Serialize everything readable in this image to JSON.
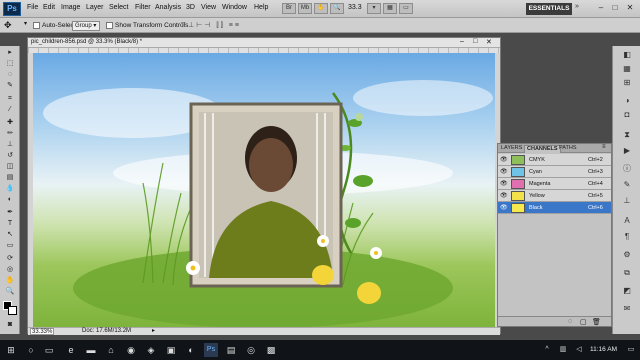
{
  "app": {
    "logo": "Ps"
  },
  "menu": [
    "File",
    "Edit",
    "Image",
    "Layer",
    "Select",
    "Filter",
    "Analysis",
    "3D",
    "View",
    "Window",
    "Help"
  ],
  "appbar": {
    "zoom": "33.3",
    "workspace": "ESSENTIALS",
    "cs_live": "»"
  },
  "options": {
    "auto_select_label": "Auto-Select:",
    "auto_select_value": "Group",
    "transform_label": "Show Transform Controls"
  },
  "document": {
    "tab_title": "pic_children-856.psd @ 33.3% (Black/8) *",
    "zoom_status": "33.33%",
    "doc_info": "Doc: 17.6M/13.2M"
  },
  "panel": {
    "tabs": [
      "LAYERS",
      "CHANNELS",
      "PATHS"
    ],
    "active_tab": "CHANNELS",
    "channels": [
      {
        "name": "CMYK",
        "shortcut": "Ctrl+2",
        "thumb_color": "#8fbf5a",
        "selected": false,
        "visible": true
      },
      {
        "name": "Cyan",
        "shortcut": "Ctrl+3",
        "thumb_color": "#6fc3e6",
        "selected": false,
        "visible": true
      },
      {
        "name": "Magenta",
        "shortcut": "Ctrl+4",
        "thumb_color": "#e06fb0",
        "selected": false,
        "visible": true
      },
      {
        "name": "Yellow",
        "shortcut": "Ctrl+5",
        "thumb_color": "#f2e14a",
        "selected": false,
        "visible": true
      },
      {
        "name": "Black",
        "shortcut": "Ctrl+6",
        "thumb_color": "#f5e94e",
        "selected": true,
        "visible": true
      }
    ]
  },
  "taskbar": {
    "time": "11:16 AM"
  },
  "colors": {
    "selection": "#3b77c9",
    "workspace_bg": "#4a4a4a"
  }
}
